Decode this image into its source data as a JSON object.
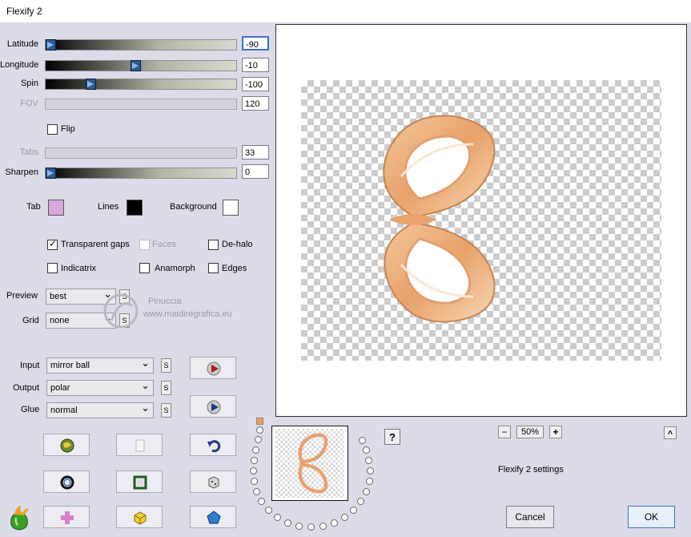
{
  "window": {
    "title": "Flexify 2"
  },
  "sliders": [
    {
      "label": "Latitude",
      "value": "-90",
      "level": 0.0,
      "enabled": true
    },
    {
      "label": "Longitude",
      "value": "-10",
      "level": 0.47,
      "enabled": true
    },
    {
      "label": "Spin",
      "value": "-100",
      "level": 0.22,
      "enabled": true
    },
    {
      "label": "FOV",
      "value": "120",
      "enabled": false
    },
    {
      "label": "Tabs",
      "value": "33",
      "enabled": false
    },
    {
      "label": "Sharpen",
      "value": "0",
      "level": 0.0,
      "enabled": true
    }
  ],
  "flip": {
    "label": "Flip",
    "checked": false
  },
  "colors": {
    "tab": {
      "label": "Tab",
      "color": "#d9a8dc"
    },
    "lines": {
      "label": "Lines",
      "color": "#000000"
    },
    "background": {
      "label": "Background",
      "color": "#ffffff"
    }
  },
  "options": {
    "transparent_gaps": {
      "label": "Transparent gaps",
      "checked": true
    },
    "faces": {
      "label": "Faces",
      "checked": false,
      "enabled": false
    },
    "dehalo": {
      "label": "De-halo",
      "checked": false
    },
    "indicatrix": {
      "label": "Indicatrix",
      "checked": false
    },
    "anamorph": {
      "label": "Anamorph",
      "checked": false
    },
    "edges": {
      "label": "Edges",
      "checked": false
    }
  },
  "preview_opts": {
    "preview_label": "Preview",
    "preview_value": "best",
    "grid_label": "Grid",
    "grid_value": "none"
  },
  "projection": {
    "input_label": "Input",
    "input_value": "mirror ball",
    "output_label": "Output",
    "output_value": "polar",
    "glue_label": "Glue",
    "glue_value": "normal",
    "s_label": "S"
  },
  "watermark": {
    "line1": "Pinuccia",
    "line2": "www.maidiregrafica.eu"
  },
  "zoom": {
    "minus": "−",
    "value": "50%",
    "plus": "+"
  },
  "help": "?",
  "caret": "^",
  "settings_label": "Flexify 2 settings",
  "buttons": {
    "cancel": "Cancel",
    "ok": "OK"
  }
}
